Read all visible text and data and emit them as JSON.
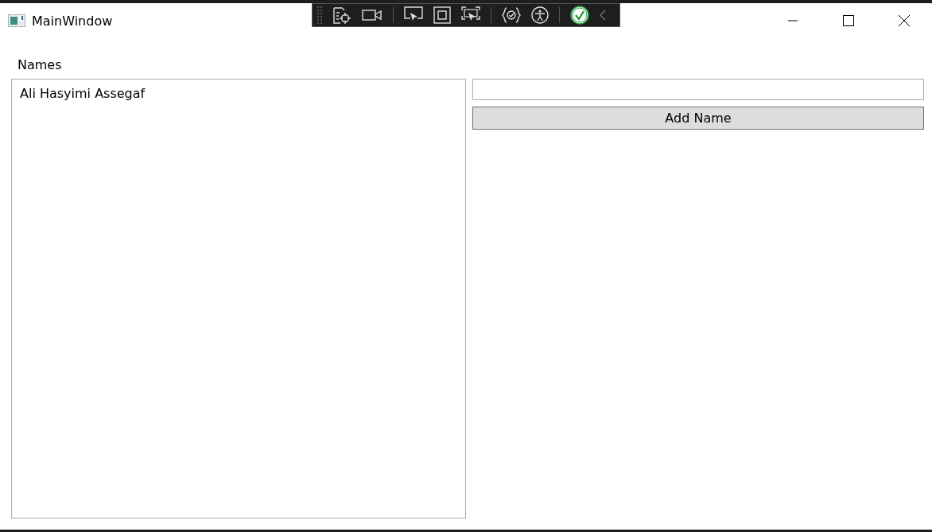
{
  "window": {
    "title": "MainWindow"
  },
  "names_label": "Names",
  "names_list": [
    {
      "text": "Ali Hasyimi Assegaf",
      "selected": false
    }
  ],
  "add_button": "Add Name"
}
